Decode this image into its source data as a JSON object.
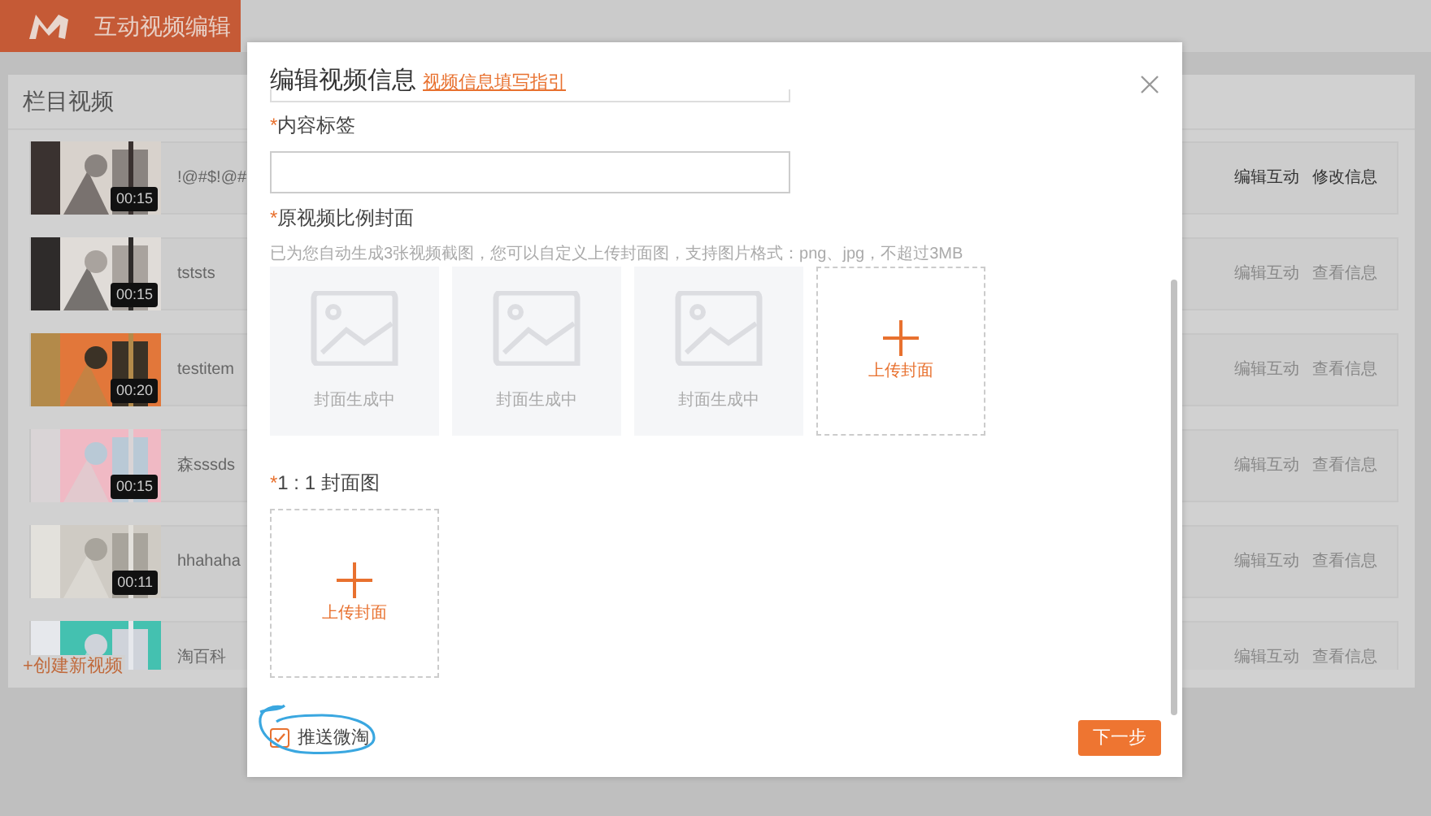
{
  "app": {
    "title": "互动视频编辑"
  },
  "panel": {
    "title": "栏目视频",
    "create_link": "+创建新视频"
  },
  "videos": [
    {
      "title": "!@#$!@#",
      "duration": "00:15",
      "actions": [
        "编辑互动",
        "修改信息"
      ],
      "editable": true
    },
    {
      "title": "tststs",
      "duration": "00:15",
      "actions": [
        "编辑互动",
        "查看信息"
      ],
      "editable": false
    },
    {
      "title": "testitem",
      "duration": "00:20",
      "actions": [
        "编辑互动",
        "查看信息"
      ],
      "editable": false
    },
    {
      "title": "森sssds",
      "duration": "00:15",
      "actions": [
        "编辑互动",
        "查看信息"
      ],
      "editable": false
    },
    {
      "title": "hhahaha",
      "duration": "00:11",
      "actions": [
        "编辑互动",
        "查看信息"
      ],
      "editable": false
    },
    {
      "title": "淘百科",
      "actions": [
        "编辑互动",
        "查看信息"
      ],
      "editable": false
    }
  ],
  "modal": {
    "title": "编辑视频信息",
    "guide_link": "视频信息填写指引",
    "tag_field": {
      "label": "内容标签",
      "required_mark": "*"
    },
    "cover_section": {
      "label": "原视频比例封面",
      "required_mark": "*",
      "hint": "已为您自动生成3张视频截图，您可以自定义上传封面图，支持图片格式：png、jpg，不超过3MB",
      "tiles": [
        {
          "kind": "placeholder",
          "caption": "封面生成中"
        },
        {
          "kind": "placeholder",
          "caption": "封面生成中"
        },
        {
          "kind": "placeholder",
          "caption": "封面生成中"
        },
        {
          "kind": "upload",
          "caption": "上传封面"
        }
      ]
    },
    "square_section": {
      "label": "1 : 1 封面图",
      "required_mark": "*",
      "tiles": [
        {
          "kind": "upload",
          "caption": "上传封面"
        }
      ]
    },
    "push_option": {
      "label": "推送微淘",
      "checked": true
    },
    "next_button": "下一步"
  }
}
